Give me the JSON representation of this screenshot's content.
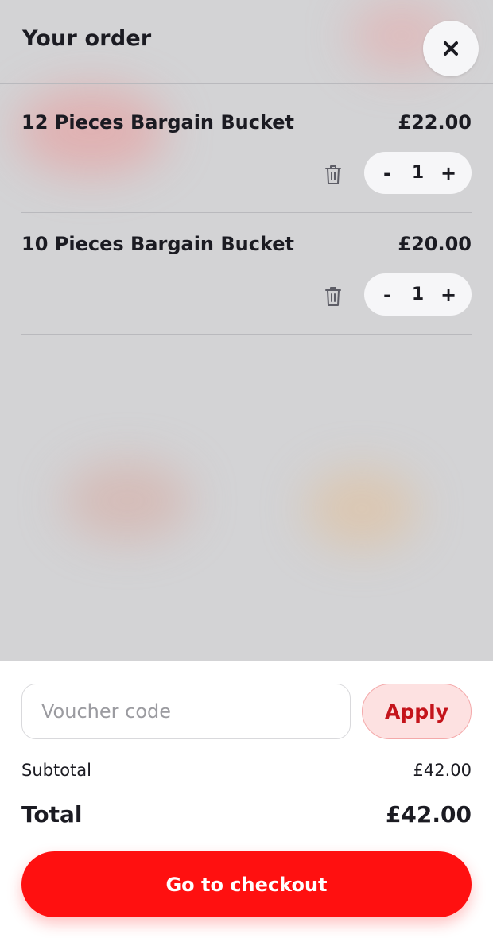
{
  "header": {
    "title": "Your order",
    "close_icon": "close-icon"
  },
  "items": [
    {
      "name": "12 Pieces Bargain Bucket",
      "price": "£22.00",
      "quantity": "1",
      "decrement": "-",
      "increment": "+",
      "delete_icon": "trash-icon"
    },
    {
      "name": "10 Pieces Bargain Bucket",
      "price": "£20.00",
      "quantity": "1",
      "decrement": "-",
      "increment": "+",
      "delete_icon": "trash-icon"
    }
  ],
  "voucher": {
    "placeholder": "Voucher code",
    "value": "",
    "apply_label": "Apply"
  },
  "summary": {
    "subtotal_label": "Subtotal",
    "subtotal_value": "£42.00",
    "total_label": "Total",
    "total_value": "£42.00"
  },
  "checkout_label": "Go to checkout",
  "colors": {
    "primary": "#ff1010",
    "apply_bg": "#fde1e1",
    "apply_text": "#c4141b",
    "text": "#1b1b22"
  }
}
